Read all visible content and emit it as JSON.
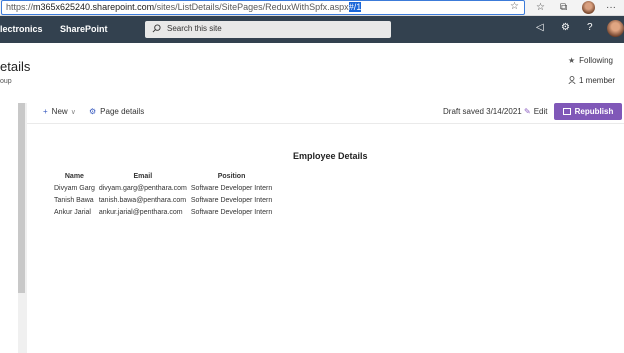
{
  "browser": {
    "url_prefix": "https://",
    "url_host": "m365x625240.sharepoint.com",
    "url_path": "/sites/ListDetails/SitePages/ReduxWithSpfx.aspx",
    "url_hash": "#/1"
  },
  "suite": {
    "site_name": "lectronics",
    "app_name": "SharePoint",
    "search_placeholder": "Search this site"
  },
  "site": {
    "title": "etails",
    "subtitle": "oup",
    "following": "Following",
    "members": "1 member"
  },
  "command_bar": {
    "new_label": "New",
    "page_details_label": "Page details",
    "draft_status": "Draft saved 3/14/2021",
    "edit_label": "Edit",
    "republish_label": "Republish"
  },
  "content": {
    "heading": "Employee Details",
    "columns": [
      "Name",
      "Email",
      "Position"
    ],
    "rows": [
      [
        "Divyam Garg",
        "divyam.garg@penthara.com",
        "Software Developer Intern"
      ],
      [
        "Tanish Bawa",
        "tanish.bawa@penthara.com",
        "Software Developer Intern"
      ],
      [
        "Ankur Jarial",
        "ankur.jarial@penthara.com",
        "Software Developer Intern"
      ]
    ]
  },
  "colors": {
    "suite_bar": "#33414f",
    "accent": "#8058b8",
    "url_selection": "#1a66d8"
  }
}
